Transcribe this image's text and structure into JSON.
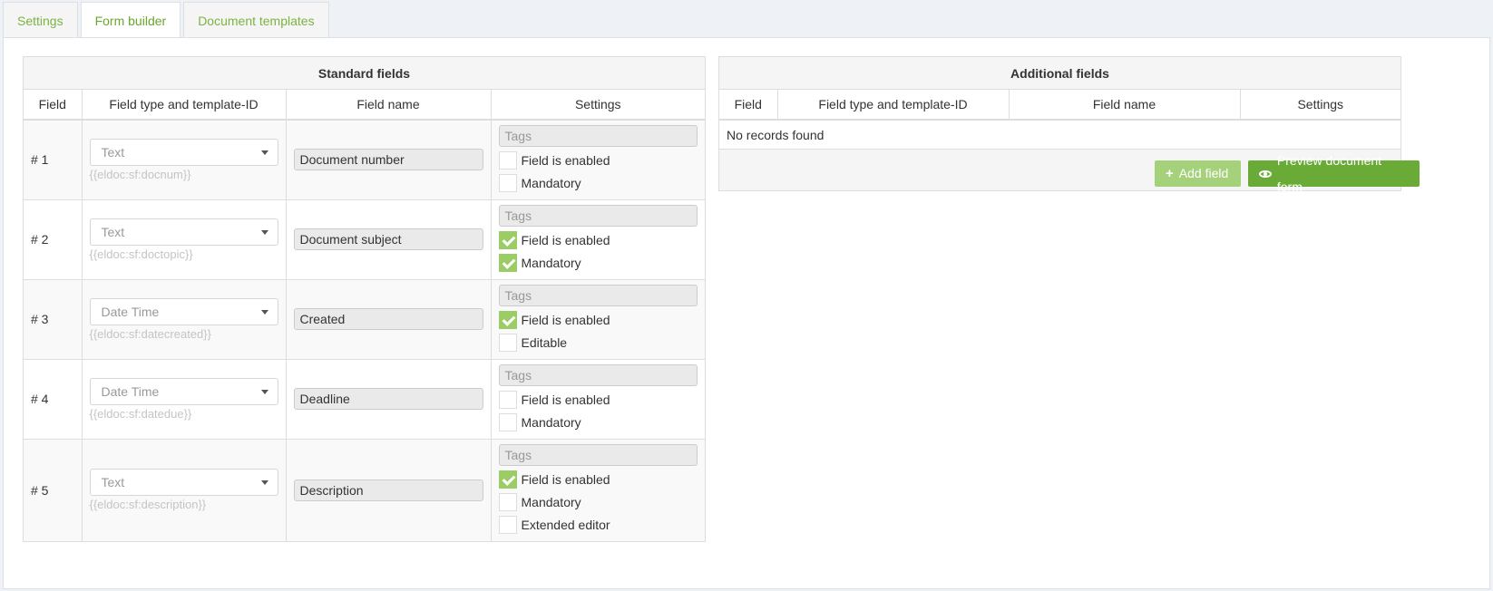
{
  "tabs": [
    {
      "label": "Settings",
      "active": false
    },
    {
      "label": "Form builder",
      "active": true
    },
    {
      "label": "Document templates",
      "active": false
    }
  ],
  "standard": {
    "title": "Standard fields",
    "columns": [
      "Field",
      "Field type and template-ID",
      "Field name",
      "Settings"
    ],
    "tags_placeholder": "Tags",
    "rows": [
      {
        "num": "# 1",
        "type": "Text",
        "tpl": "{{eldoc:sf:docnum}}",
        "name": "Document number",
        "checks": [
          {
            "label": "Field is enabled",
            "checked": false
          },
          {
            "label": "Mandatory",
            "checked": false
          }
        ]
      },
      {
        "num": "# 2",
        "type": "Text",
        "tpl": "{{eldoc:sf:doctopic}}",
        "name": "Document subject",
        "checks": [
          {
            "label": "Field is enabled",
            "checked": true
          },
          {
            "label": "Mandatory",
            "checked": true
          }
        ]
      },
      {
        "num": "# 3",
        "type": "Date Time",
        "tpl": "{{eldoc:sf:datecreated}}",
        "name": "Created",
        "checks": [
          {
            "label": "Field is enabled",
            "checked": true
          },
          {
            "label": "Editable",
            "checked": false
          }
        ]
      },
      {
        "num": "# 4",
        "type": "Date Time",
        "tpl": "{{eldoc:sf:datedue}}",
        "name": "Deadline",
        "checks": [
          {
            "label": "Field is enabled",
            "checked": false
          },
          {
            "label": "Mandatory",
            "checked": false
          }
        ]
      },
      {
        "num": "# 5",
        "type": "Text",
        "tpl": "{{eldoc:sf:description}}",
        "name": "Description",
        "checks": [
          {
            "label": "Field is enabled",
            "checked": true
          },
          {
            "label": "Mandatory",
            "checked": false
          },
          {
            "label": "Extended editor",
            "checked": false
          }
        ]
      }
    ]
  },
  "additional": {
    "title": "Additional fields",
    "columns": [
      "Field",
      "Field type and template-ID",
      "Field name",
      "Settings"
    ],
    "empty_text": "No records found",
    "add_label": "Add field",
    "preview_label": "Preview document form"
  }
}
